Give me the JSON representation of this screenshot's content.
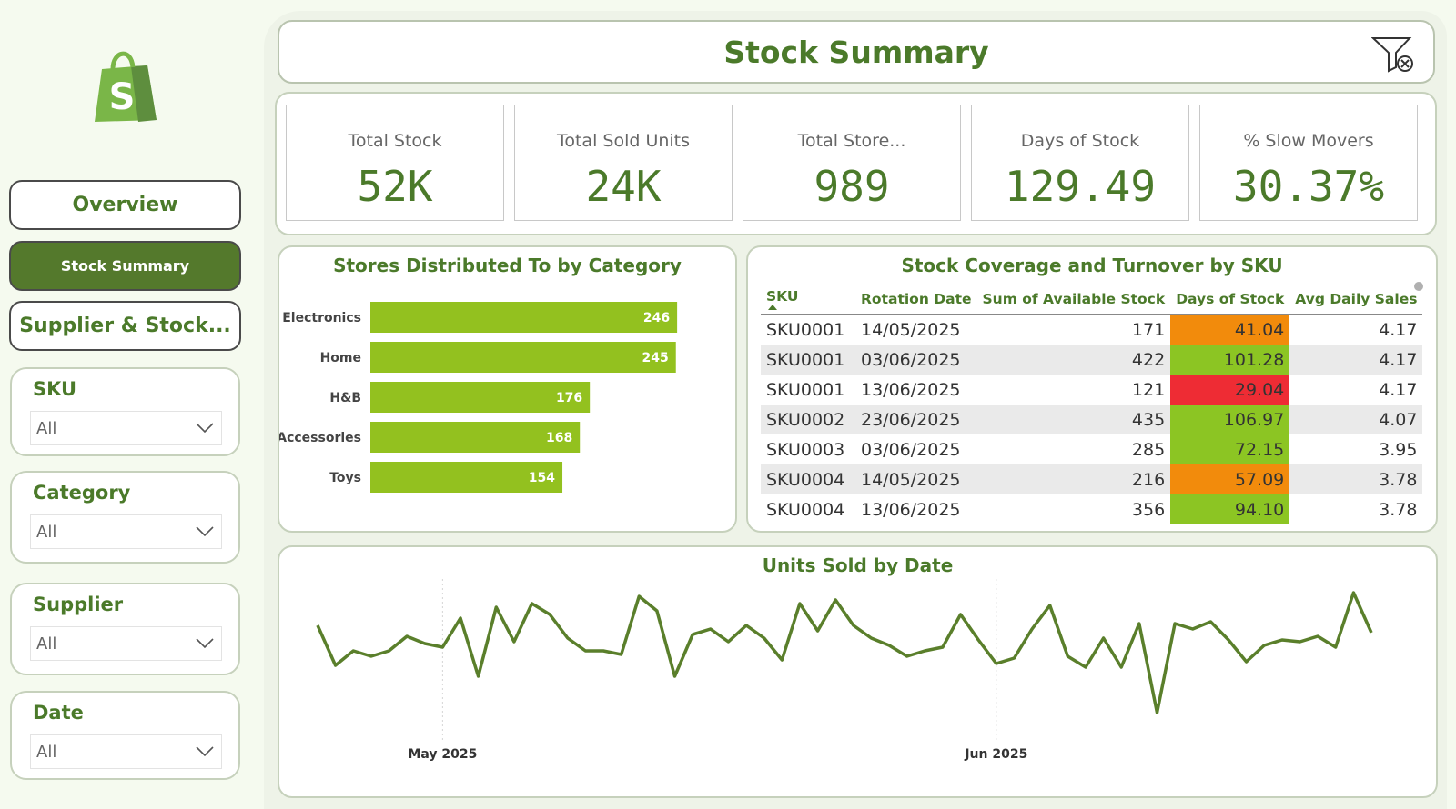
{
  "sidebar": {
    "logo_letter": "S",
    "nav": [
      {
        "label": "Overview"
      },
      {
        "label": "Stock Summary"
      },
      {
        "label": "Supplier & Stock..."
      }
    ],
    "slicers": [
      {
        "title": "SKU",
        "value": "All"
      },
      {
        "title": "Category",
        "value": "All"
      },
      {
        "title": "Supplier",
        "value": "All"
      },
      {
        "title": "Date",
        "value": "All"
      }
    ]
  },
  "header": {
    "title": "Stock Summary"
  },
  "kpis": [
    {
      "label": "Total Stock",
      "value": "52K"
    },
    {
      "label": "Total Sold Units",
      "value": "24K"
    },
    {
      "label": "Total Store...",
      "value": "989"
    },
    {
      "label": "Days of Stock",
      "value": "129.49"
    },
    {
      "label": "% Slow Movers",
      "value": "30.37%"
    }
  ],
  "colors": {
    "brand_green": "#4b7a2a",
    "bar_green": "#93c11f",
    "line_green": "#5a7f2b",
    "orange": "#f28b0c",
    "light_green": "#8cc523",
    "red": "#ee2c34"
  },
  "bar_chart": {
    "title": "Stores Distributed To by Category",
    "chart_data": {
      "type": "bar",
      "orientation": "horizontal",
      "categories": [
        "Electronics",
        "Home",
        "H&B",
        "Accessories",
        "Toys"
      ],
      "values": [
        246,
        245,
        176,
        168,
        154
      ],
      "xlim": [
        0,
        270
      ]
    }
  },
  "table": {
    "title": "Stock Coverage and Turnover by SKU",
    "columns": [
      "SKU",
      "Rotation Date",
      "Sum of Available Stock",
      "Days of Stock",
      "Avg Daily Sales"
    ],
    "rows": [
      {
        "sku": "SKU0001",
        "date": "14/05/2025",
        "stock": "171",
        "days": "41.04",
        "avg": "4.17",
        "days_color": "orange"
      },
      {
        "sku": "SKU0001",
        "date": "03/06/2025",
        "stock": "422",
        "days": "101.28",
        "avg": "4.17",
        "days_color": "green"
      },
      {
        "sku": "SKU0001",
        "date": "13/06/2025",
        "stock": "121",
        "days": "29.04",
        "avg": "4.17",
        "days_color": "red"
      },
      {
        "sku": "SKU0002",
        "date": "23/06/2025",
        "stock": "435",
        "days": "106.97",
        "avg": "4.07",
        "days_color": "green"
      },
      {
        "sku": "SKU0003",
        "date": "03/06/2025",
        "stock": "285",
        "days": "72.15",
        "avg": "3.95",
        "days_color": "green"
      },
      {
        "sku": "SKU0004",
        "date": "14/05/2025",
        "stock": "216",
        "days": "57.09",
        "avg": "3.78",
        "days_color": "orange"
      },
      {
        "sku": "SKU0004",
        "date": "13/06/2025",
        "stock": "356",
        "days": "94.10",
        "avg": "3.78",
        "days_color": "green"
      }
    ]
  },
  "line_chart": {
    "title": "Units Sold by Date",
    "chart_data": {
      "type": "line",
      "x_ticks": [
        "May 2025",
        "Jun 2025"
      ],
      "x_tick_positions": [
        7,
        38
      ],
      "values": [
        52,
        30,
        38,
        35,
        38,
        46,
        42,
        40,
        56,
        24,
        62,
        43,
        64,
        58,
        45,
        38,
        38,
        36,
        68,
        60,
        24,
        47,
        50,
        43,
        52,
        45,
        33,
        64,
        49,
        66,
        52,
        45,
        41,
        35,
        38,
        40,
        58,
        44,
        31,
        34,
        50,
        63,
        35,
        29,
        45,
        29,
        53,
        4,
        53,
        50,
        54,
        44,
        32,
        41,
        44,
        43,
        46,
        40,
        70,
        48
      ],
      "ylim": [
        0,
        80
      ]
    }
  }
}
